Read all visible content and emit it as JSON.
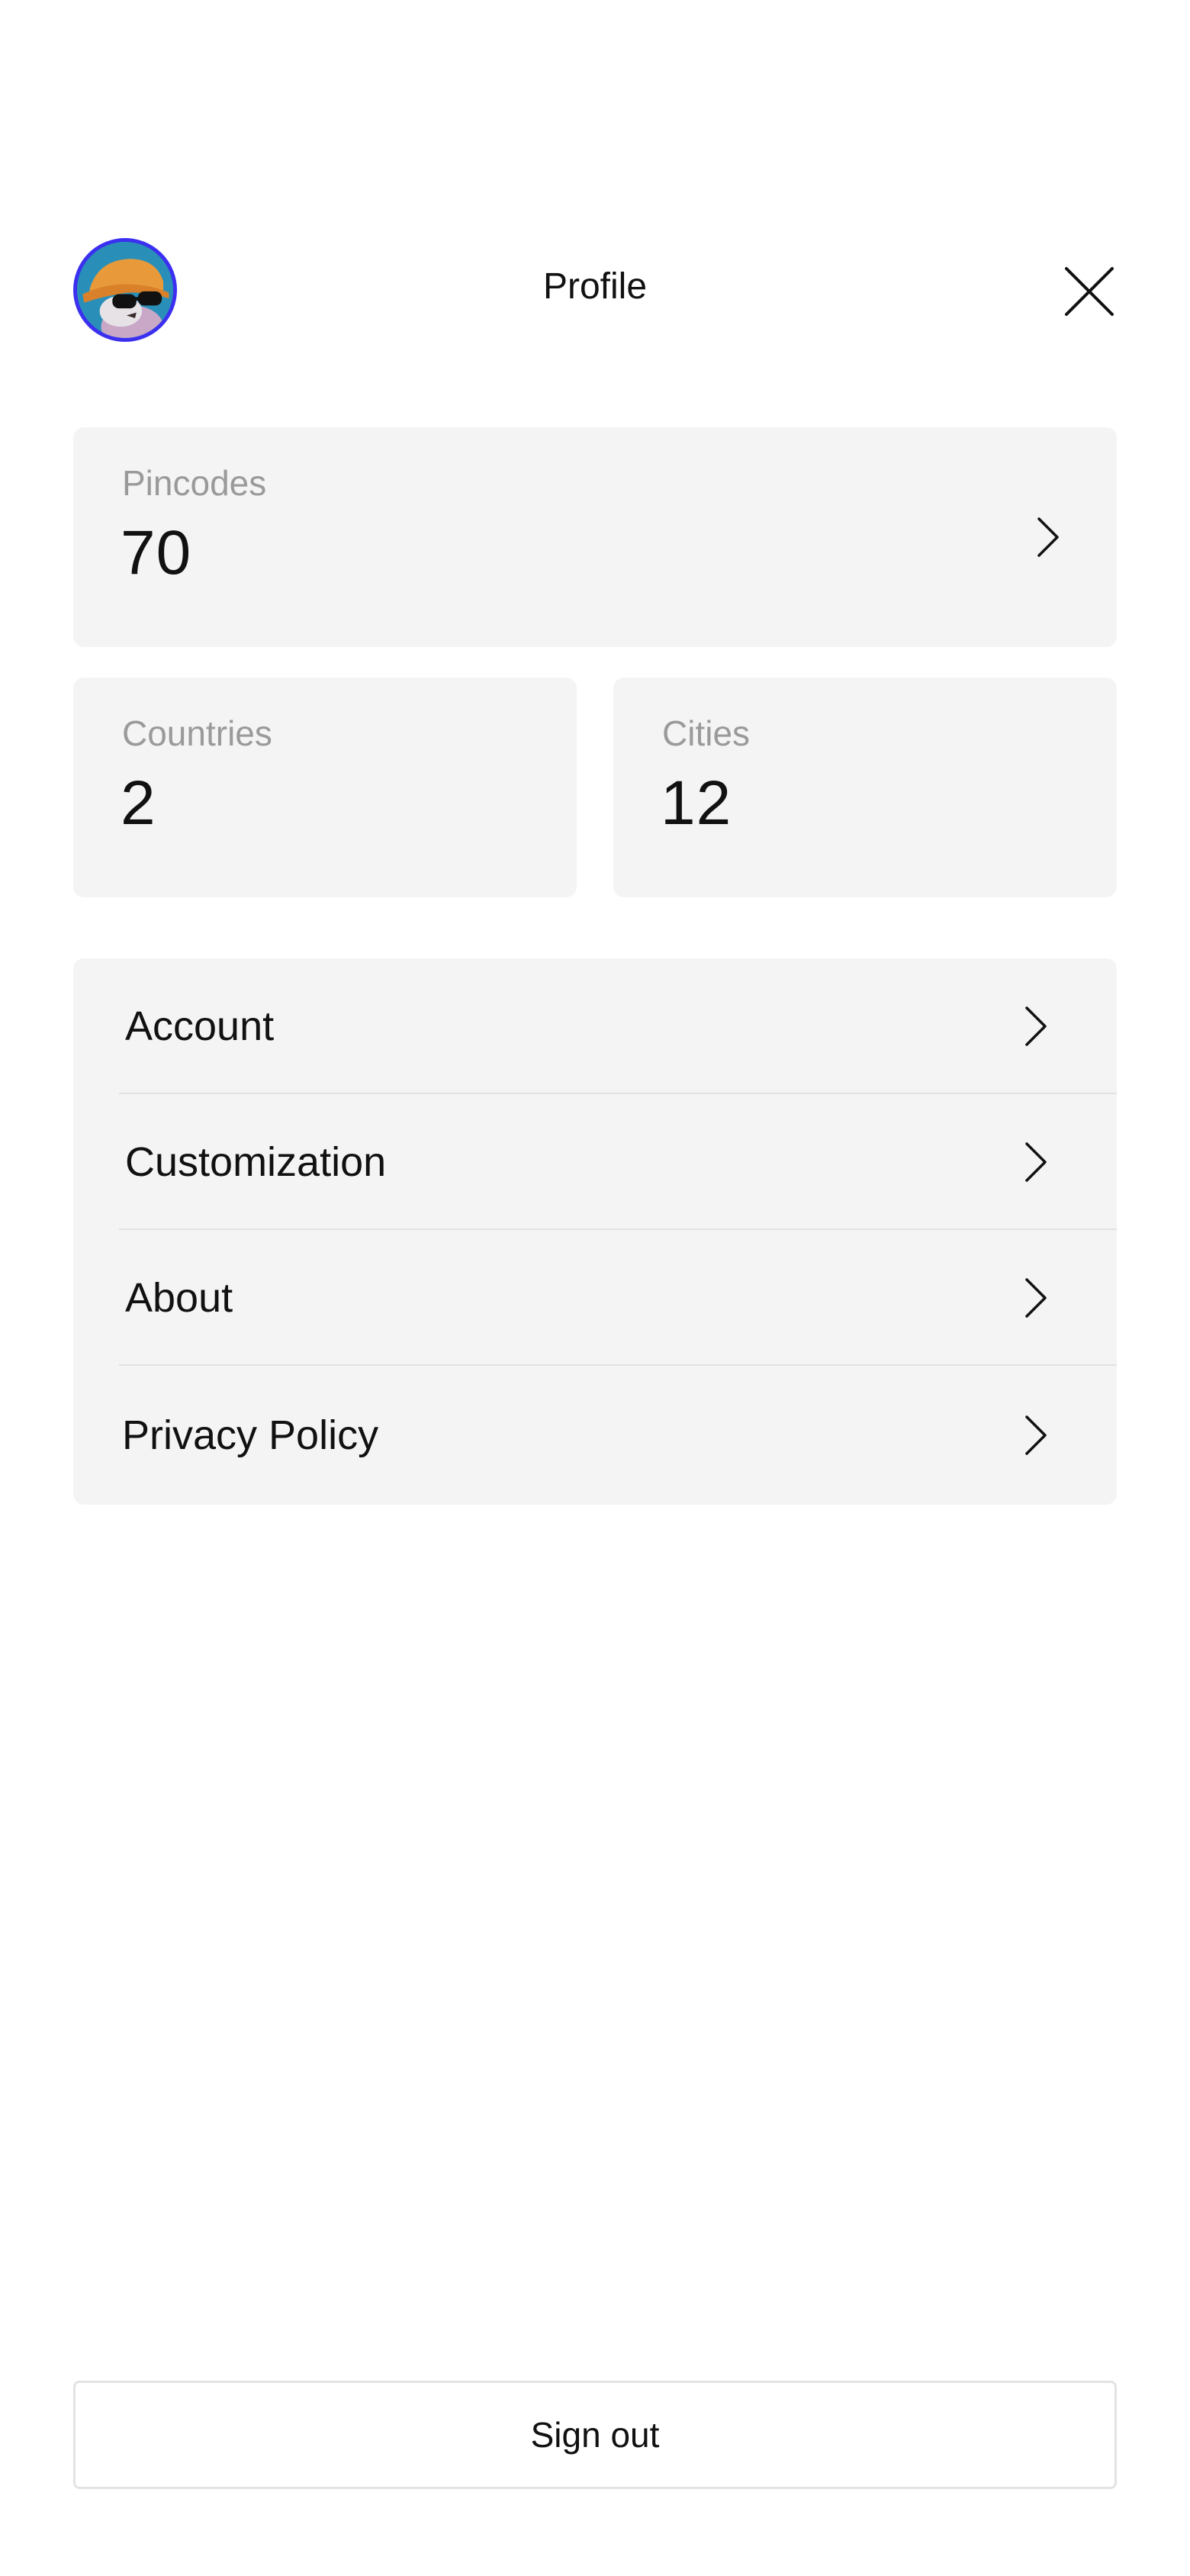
{
  "header": {
    "title": "Profile",
    "avatar_icon": "avatar-icon",
    "close_icon": "close-icon"
  },
  "stats": {
    "pincodes": {
      "label": "Pincodes",
      "value": "70"
    },
    "countries": {
      "label": "Countries",
      "value": "2"
    },
    "cities": {
      "label": "Cities",
      "value": "12"
    }
  },
  "menu": {
    "items": [
      {
        "label": "Account"
      },
      {
        "label": "Customization"
      },
      {
        "label": "About"
      },
      {
        "label": "Privacy Policy"
      }
    ]
  },
  "footer": {
    "signout_label": "Sign out"
  },
  "colors": {
    "background": "#ffffff",
    "card_background": "#f4f4f4",
    "muted_text": "#9a9a9a",
    "avatar_ring": "#3b2ff0"
  }
}
